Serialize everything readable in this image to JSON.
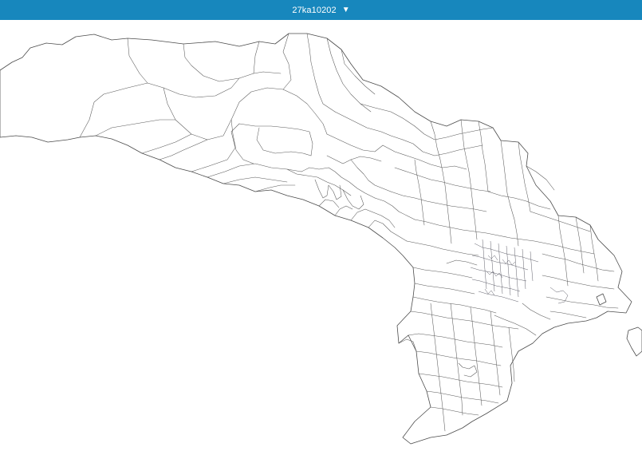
{
  "header": {
    "selector_label": "27ka10202",
    "dropdown_icon": "triangle-down-icon",
    "background_color": "#1787bd",
    "text_color": "#ffffff"
  },
  "map": {
    "style": "outline-only boundary map",
    "fill_color": "#ffffff",
    "stroke_color": "#4b4b4b"
  }
}
